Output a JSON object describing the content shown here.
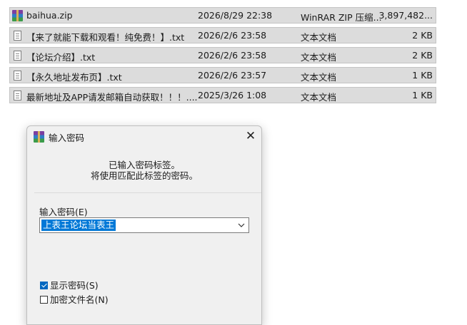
{
  "files": [
    {
      "name": "baihua.zip",
      "date": "2026/8/29 22:38",
      "type": "WinRAR ZIP 压缩...",
      "size": "3,897,482...",
      "icon": "winrar-zip-icon"
    },
    {
      "name": "【来了就能下载和观看！纯免费！】.txt",
      "date": "2026/2/6 23:58",
      "type": "文本文档",
      "size": "2 KB",
      "icon": "text-file-icon"
    },
    {
      "name": "【论坛介绍】.txt",
      "date": "2026/2/6 23:58",
      "type": "文本文档",
      "size": "2 KB",
      "icon": "text-file-icon"
    },
    {
      "name": "【永久地址发布页】.txt",
      "date": "2026/2/6 23:57",
      "type": "文本文档",
      "size": "1 KB",
      "icon": "text-file-icon"
    },
    {
      "name": "最新地址及APP请发邮箱自动获取！！！....",
      "date": "2025/3/26 1:08",
      "type": "文本文档",
      "size": "1 KB",
      "icon": "text-file-icon"
    }
  ],
  "dialog": {
    "title": "输入密码",
    "close_glyph": "✕",
    "message_line1": "已输入密码标签。",
    "message_line2": "将使用匹配此标签的密码。",
    "password_label": "输入密码(E)",
    "password_value": "上表王论坛当表王",
    "show_password_label": "显示密码(S)",
    "show_password_checked": true,
    "encrypt_names_label": "加密文件名(N)",
    "encrypt_names_checked": false
  }
}
